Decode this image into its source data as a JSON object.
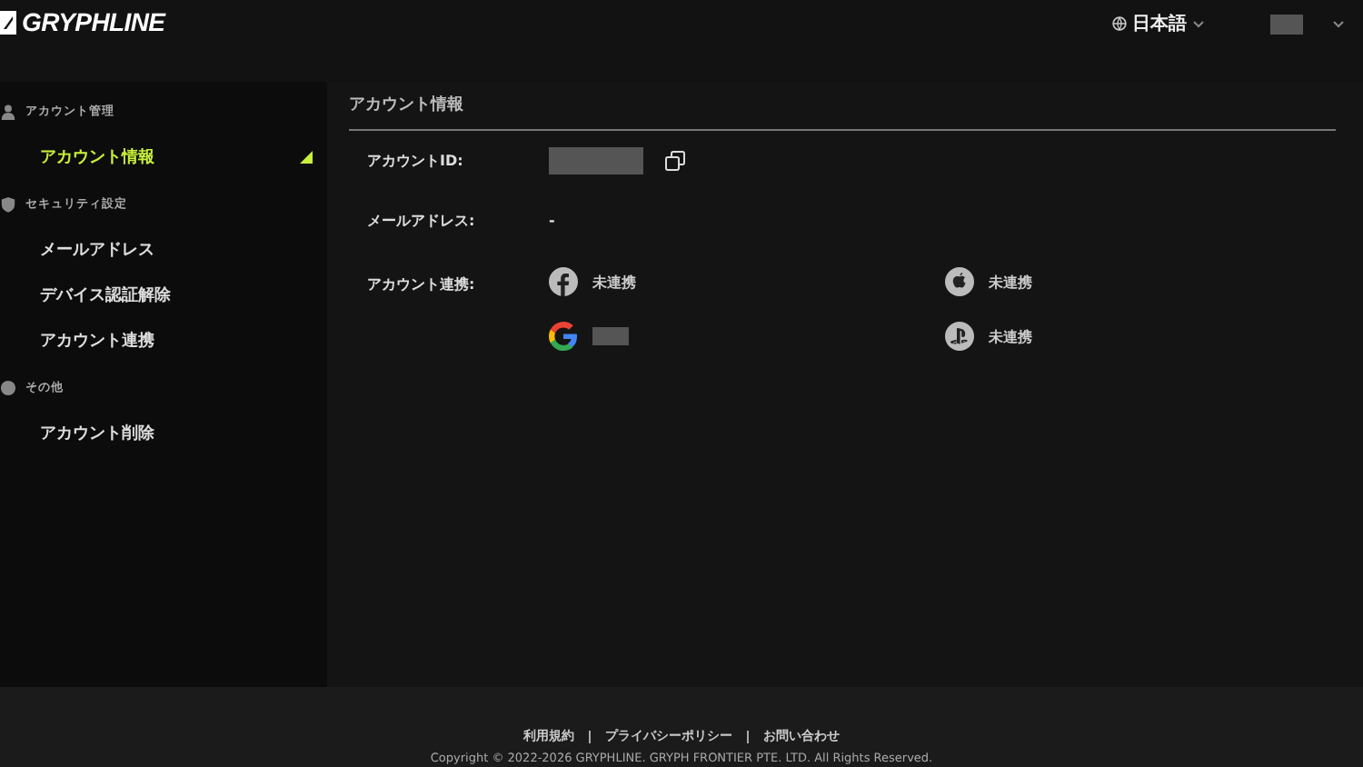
{
  "header": {
    "logo": "GRYPHLINE",
    "language": "日本語"
  },
  "sidebar": {
    "groups": [
      {
        "kind": "user",
        "title": "アカウント管理",
        "items": [
          {
            "label": "アカウント情報",
            "selected": true
          }
        ]
      },
      {
        "kind": "shield",
        "title": "セキュリティ設定",
        "items": [
          {
            "label": "メールアドレス",
            "selected": false
          },
          {
            "label": "デバイス認証解除",
            "selected": false
          },
          {
            "label": "アカウント連携",
            "selected": false
          }
        ]
      },
      {
        "kind": "other",
        "title": "その他",
        "items": [
          {
            "label": "アカウント削除",
            "selected": false
          }
        ]
      }
    ]
  },
  "main": {
    "title": "アカウント情報",
    "fields": [
      {
        "kind": "id",
        "label": "アカウントID:"
      },
      {
        "kind": "text",
        "label": "メールアドレス:",
        "value": "-"
      }
    ],
    "connections_label": "アカウント連携:",
    "connections": [
      {
        "kind": "facebook",
        "linked": false,
        "status": "未連携"
      },
      {
        "kind": "apple",
        "linked": false,
        "status": "未連携"
      },
      {
        "kind": "google",
        "linked": true
      },
      {
        "kind": "playstation",
        "linked": false,
        "status": "未連携"
      }
    ]
  },
  "footer": {
    "links": [
      "利用規約",
      "プライバシーポリシー",
      "お問い合わせ"
    ],
    "copyright": "Copyright © 2022-2026 GRYPHLINE. GRYPH FRONTIER PTE. LTD. All Rights Reserved."
  }
}
